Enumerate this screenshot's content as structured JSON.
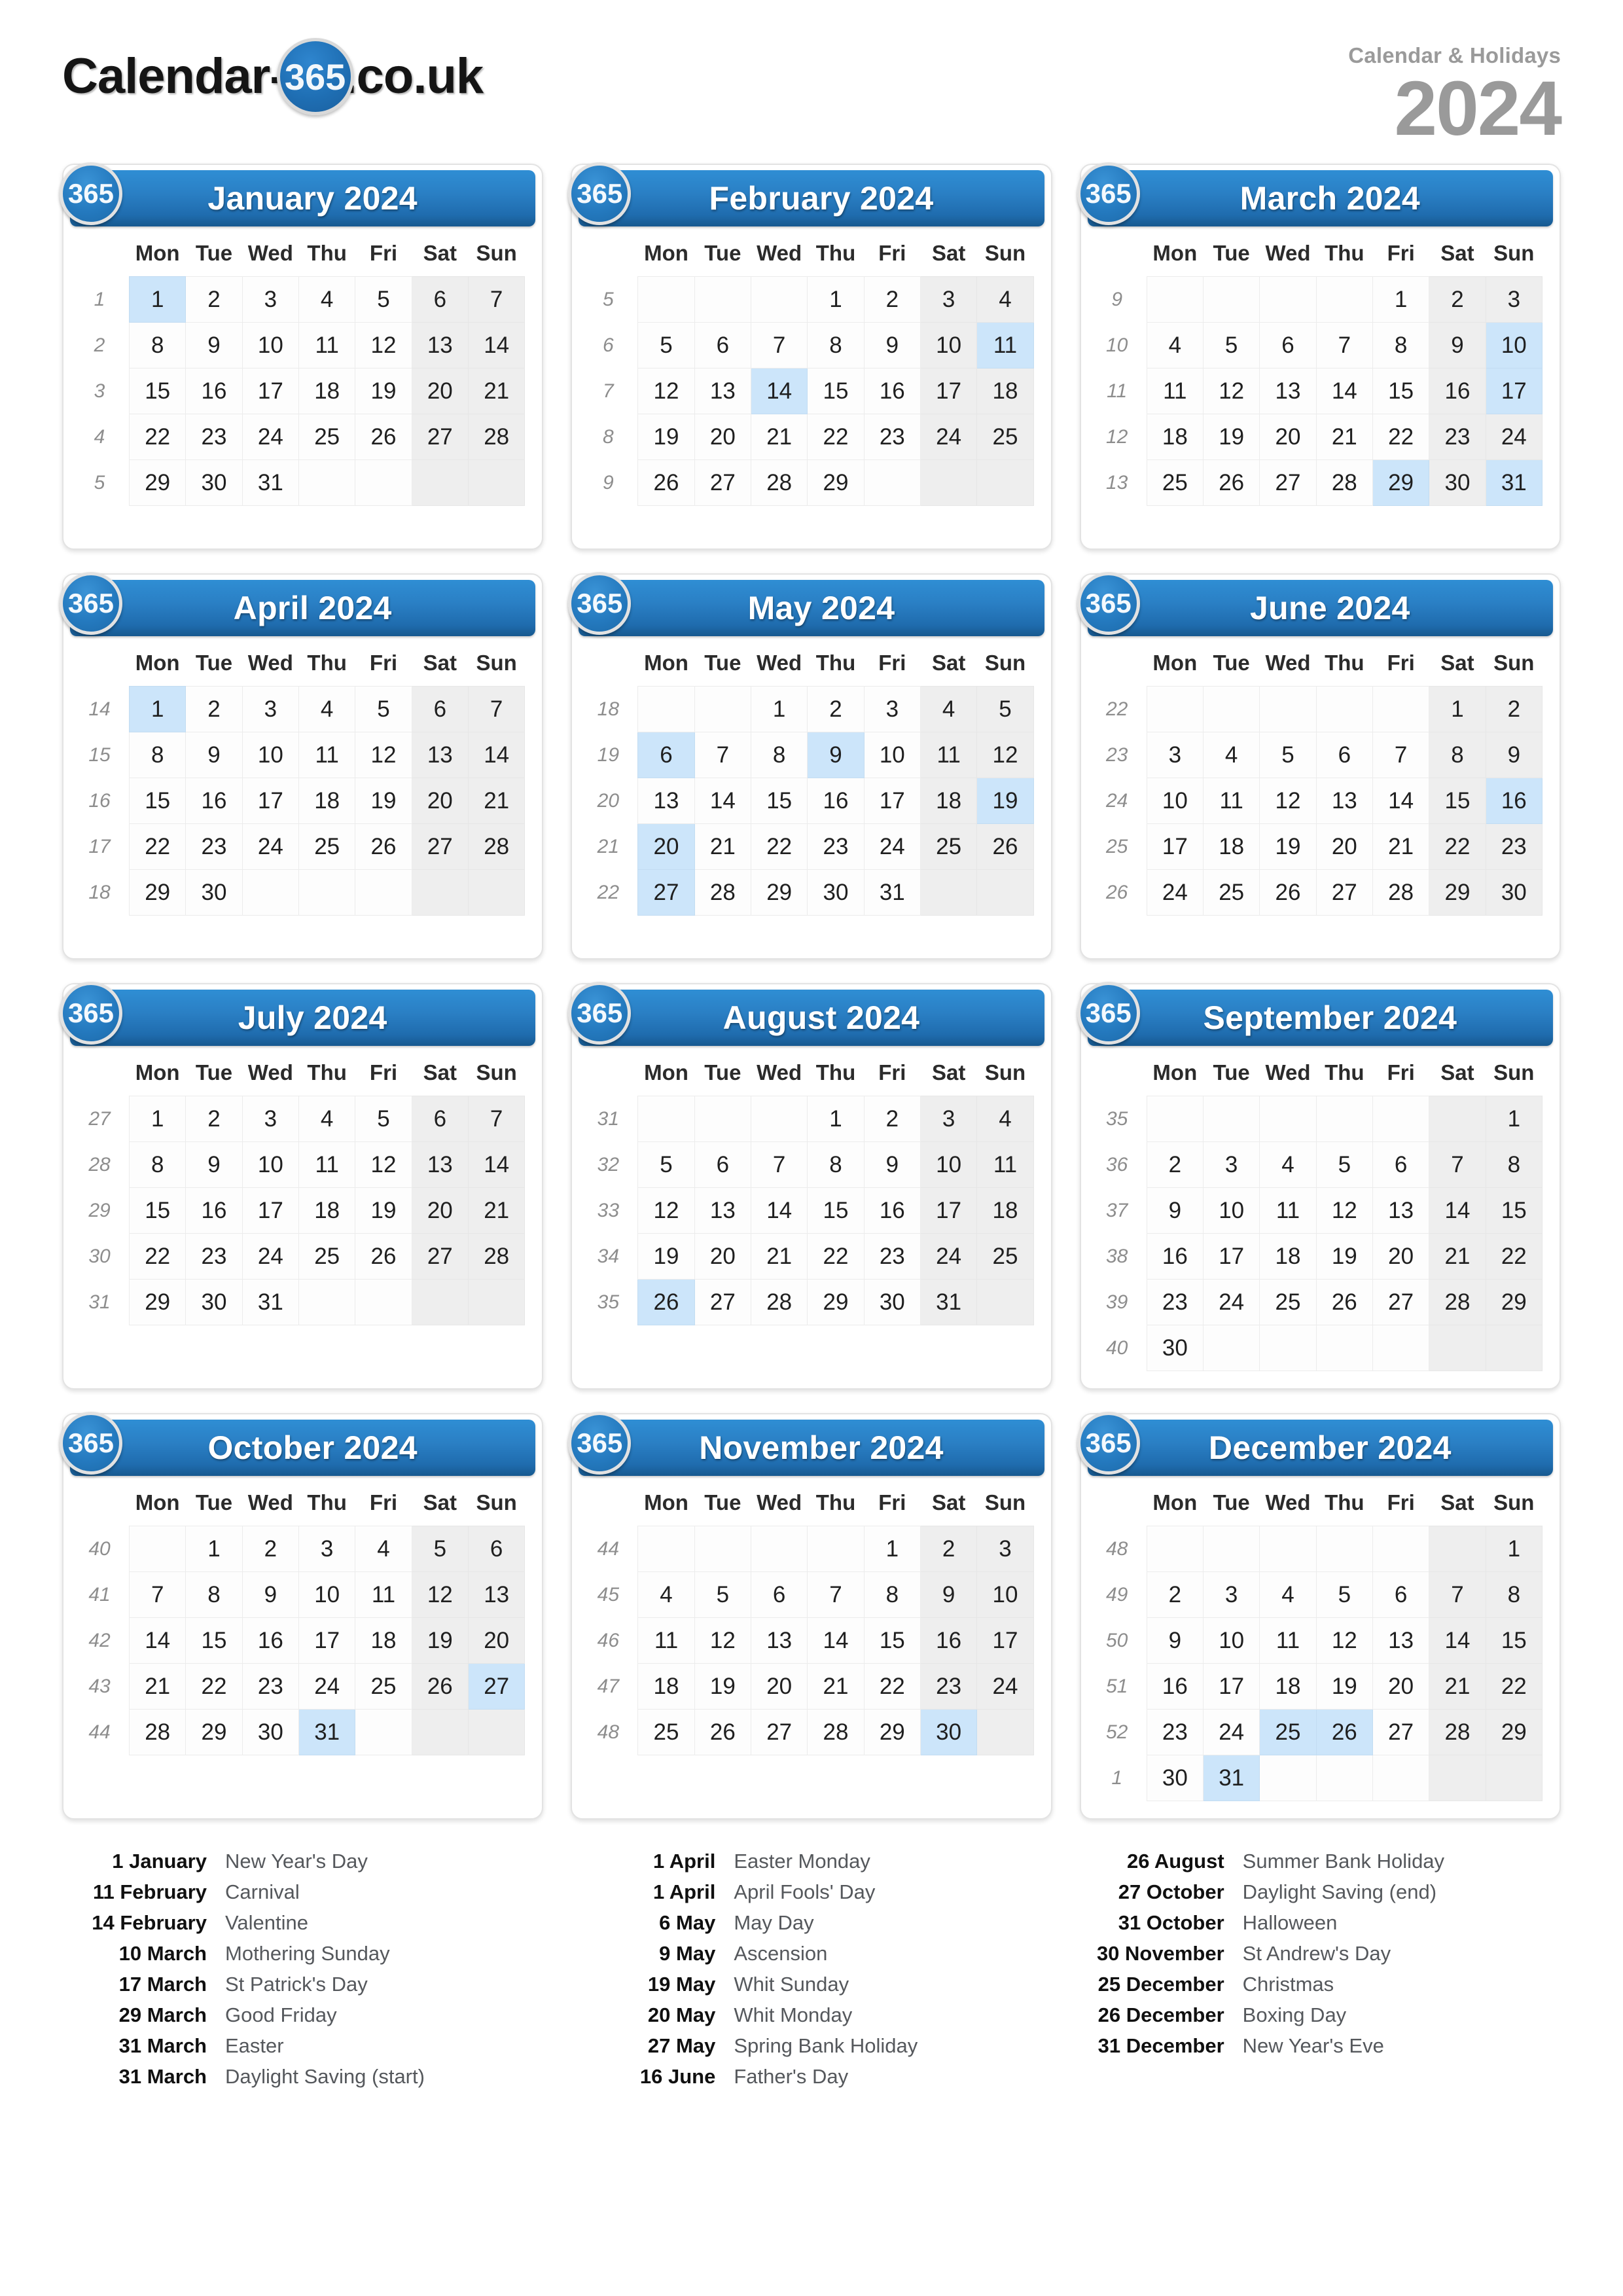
{
  "header": {
    "logo_prefix": "Calendar-",
    "logo_badge": "365",
    "logo_suffix": ".co.uk",
    "kicker": "Calendar & Holidays",
    "year": "2024"
  },
  "colors": {
    "header_blue": "#2a7fc4",
    "badge_blue": "#2479be",
    "highlight": "#cce5fa",
    "weekend": "#eeeeee",
    "muted_text": "#9a9a9a"
  },
  "weekday_labels": [
    "Mon",
    "Tue",
    "Wed",
    "Thu",
    "Fri",
    "Sat",
    "Sun"
  ],
  "badge_label": "365",
  "months": [
    {
      "title": "January 2024",
      "weeks": [
        {
          "no": "1",
          "days": [
            "1",
            "2",
            "3",
            "4",
            "5",
            "6",
            "7"
          ],
          "hl": [
            1
          ]
        },
        {
          "no": "2",
          "days": [
            "8",
            "9",
            "10",
            "11",
            "12",
            "13",
            "14"
          ],
          "hl": []
        },
        {
          "no": "3",
          "days": [
            "15",
            "16",
            "17",
            "18",
            "19",
            "20",
            "21"
          ],
          "hl": []
        },
        {
          "no": "4",
          "days": [
            "22",
            "23",
            "24",
            "25",
            "26",
            "27",
            "28"
          ],
          "hl": []
        },
        {
          "no": "5",
          "days": [
            "29",
            "30",
            "31",
            "",
            "",
            "",
            ""
          ],
          "hl": []
        }
      ]
    },
    {
      "title": "February 2024",
      "weeks": [
        {
          "no": "5",
          "days": [
            "",
            "",
            "",
            "1",
            "2",
            "3",
            "4"
          ],
          "hl": []
        },
        {
          "no": "6",
          "days": [
            "5",
            "6",
            "7",
            "8",
            "9",
            "10",
            "11"
          ],
          "hl": [
            11
          ]
        },
        {
          "no": "7",
          "days": [
            "12",
            "13",
            "14",
            "15",
            "16",
            "17",
            "18"
          ],
          "hl": [
            14
          ]
        },
        {
          "no": "8",
          "days": [
            "19",
            "20",
            "21",
            "22",
            "23",
            "24",
            "25"
          ],
          "hl": []
        },
        {
          "no": "9",
          "days": [
            "26",
            "27",
            "28",
            "29",
            "",
            "",
            ""
          ],
          "hl": []
        }
      ]
    },
    {
      "title": "March 2024",
      "weeks": [
        {
          "no": "9",
          "days": [
            "",
            "",
            "",
            "",
            "1",
            "2",
            "3"
          ],
          "hl": []
        },
        {
          "no": "10",
          "days": [
            "4",
            "5",
            "6",
            "7",
            "8",
            "9",
            "10"
          ],
          "hl": [
            10
          ]
        },
        {
          "no": "11",
          "days": [
            "11",
            "12",
            "13",
            "14",
            "15",
            "16",
            "17"
          ],
          "hl": [
            17
          ]
        },
        {
          "no": "12",
          "days": [
            "18",
            "19",
            "20",
            "21",
            "22",
            "23",
            "24"
          ],
          "hl": []
        },
        {
          "no": "13",
          "days": [
            "25",
            "26",
            "27",
            "28",
            "29",
            "30",
            "31"
          ],
          "hl": [
            29,
            31
          ]
        }
      ]
    },
    {
      "title": "April 2024",
      "weeks": [
        {
          "no": "14",
          "days": [
            "1",
            "2",
            "3",
            "4",
            "5",
            "6",
            "7"
          ],
          "hl": [
            1
          ]
        },
        {
          "no": "15",
          "days": [
            "8",
            "9",
            "10",
            "11",
            "12",
            "13",
            "14"
          ],
          "hl": []
        },
        {
          "no": "16",
          "days": [
            "15",
            "16",
            "17",
            "18",
            "19",
            "20",
            "21"
          ],
          "hl": []
        },
        {
          "no": "17",
          "days": [
            "22",
            "23",
            "24",
            "25",
            "26",
            "27",
            "28"
          ],
          "hl": []
        },
        {
          "no": "18",
          "days": [
            "29",
            "30",
            "",
            "",
            "",
            "",
            ""
          ],
          "hl": []
        }
      ]
    },
    {
      "title": "May 2024",
      "weeks": [
        {
          "no": "18",
          "days": [
            "",
            "",
            "1",
            "2",
            "3",
            "4",
            "5"
          ],
          "hl": []
        },
        {
          "no": "19",
          "days": [
            "6",
            "7",
            "8",
            "9",
            "10",
            "11",
            "12"
          ],
          "hl": [
            6,
            9
          ]
        },
        {
          "no": "20",
          "days": [
            "13",
            "14",
            "15",
            "16",
            "17",
            "18",
            "19"
          ],
          "hl": [
            19
          ]
        },
        {
          "no": "21",
          "days": [
            "20",
            "21",
            "22",
            "23",
            "24",
            "25",
            "26"
          ],
          "hl": [
            20
          ]
        },
        {
          "no": "22",
          "days": [
            "27",
            "28",
            "29",
            "30",
            "31",
            "",
            ""
          ],
          "hl": [
            27
          ]
        }
      ]
    },
    {
      "title": "June 2024",
      "weeks": [
        {
          "no": "22",
          "days": [
            "",
            "",
            "",
            "",
            "",
            "1",
            "2"
          ],
          "hl": []
        },
        {
          "no": "23",
          "days": [
            "3",
            "4",
            "5",
            "6",
            "7",
            "8",
            "9"
          ],
          "hl": []
        },
        {
          "no": "24",
          "days": [
            "10",
            "11",
            "12",
            "13",
            "14",
            "15",
            "16"
          ],
          "hl": [
            16
          ]
        },
        {
          "no": "25",
          "days": [
            "17",
            "18",
            "19",
            "20",
            "21",
            "22",
            "23"
          ],
          "hl": []
        },
        {
          "no": "26",
          "days": [
            "24",
            "25",
            "26",
            "27",
            "28",
            "29",
            "30"
          ],
          "hl": []
        }
      ]
    },
    {
      "title": "July 2024",
      "weeks": [
        {
          "no": "27",
          "days": [
            "1",
            "2",
            "3",
            "4",
            "5",
            "6",
            "7"
          ],
          "hl": []
        },
        {
          "no": "28",
          "days": [
            "8",
            "9",
            "10",
            "11",
            "12",
            "13",
            "14"
          ],
          "hl": []
        },
        {
          "no": "29",
          "days": [
            "15",
            "16",
            "17",
            "18",
            "19",
            "20",
            "21"
          ],
          "hl": []
        },
        {
          "no": "30",
          "days": [
            "22",
            "23",
            "24",
            "25",
            "26",
            "27",
            "28"
          ],
          "hl": []
        },
        {
          "no": "31",
          "days": [
            "29",
            "30",
            "31",
            "",
            "",
            "",
            ""
          ],
          "hl": []
        }
      ]
    },
    {
      "title": "August 2024",
      "weeks": [
        {
          "no": "31",
          "days": [
            "",
            "",
            "",
            "1",
            "2",
            "3",
            "4"
          ],
          "hl": []
        },
        {
          "no": "32",
          "days": [
            "5",
            "6",
            "7",
            "8",
            "9",
            "10",
            "11"
          ],
          "hl": []
        },
        {
          "no": "33",
          "days": [
            "12",
            "13",
            "14",
            "15",
            "16",
            "17",
            "18"
          ],
          "hl": []
        },
        {
          "no": "34",
          "days": [
            "19",
            "20",
            "21",
            "22",
            "23",
            "24",
            "25"
          ],
          "hl": []
        },
        {
          "no": "35",
          "days": [
            "26",
            "27",
            "28",
            "29",
            "30",
            "31",
            ""
          ],
          "hl": [
            26
          ]
        }
      ]
    },
    {
      "title": "September 2024",
      "weeks": [
        {
          "no": "35",
          "days": [
            "",
            "",
            "",
            "",
            "",
            "",
            "1"
          ],
          "hl": []
        },
        {
          "no": "36",
          "days": [
            "2",
            "3",
            "4",
            "5",
            "6",
            "7",
            "8"
          ],
          "hl": []
        },
        {
          "no": "37",
          "days": [
            "9",
            "10",
            "11",
            "12",
            "13",
            "14",
            "15"
          ],
          "hl": []
        },
        {
          "no": "38",
          "days": [
            "16",
            "17",
            "18",
            "19",
            "20",
            "21",
            "22"
          ],
          "hl": []
        },
        {
          "no": "39",
          "days": [
            "23",
            "24",
            "25",
            "26",
            "27",
            "28",
            "29"
          ],
          "hl": []
        },
        {
          "no": "40",
          "days": [
            "30",
            "",
            "",
            "",
            "",
            "",
            ""
          ],
          "hl": []
        }
      ]
    },
    {
      "title": "October 2024",
      "weeks": [
        {
          "no": "40",
          "days": [
            "",
            "1",
            "2",
            "3",
            "4",
            "5",
            "6"
          ],
          "hl": []
        },
        {
          "no": "41",
          "days": [
            "7",
            "8",
            "9",
            "10",
            "11",
            "12",
            "13"
          ],
          "hl": []
        },
        {
          "no": "42",
          "days": [
            "14",
            "15",
            "16",
            "17",
            "18",
            "19",
            "20"
          ],
          "hl": []
        },
        {
          "no": "43",
          "days": [
            "21",
            "22",
            "23",
            "24",
            "25",
            "26",
            "27"
          ],
          "hl": [
            27
          ]
        },
        {
          "no": "44",
          "days": [
            "28",
            "29",
            "30",
            "31",
            "",
            "",
            ""
          ],
          "hl": [
            31
          ]
        }
      ]
    },
    {
      "title": "November 2024",
      "weeks": [
        {
          "no": "44",
          "days": [
            "",
            "",
            "",
            "",
            "1",
            "2",
            "3"
          ],
          "hl": []
        },
        {
          "no": "45",
          "days": [
            "4",
            "5",
            "6",
            "7",
            "8",
            "9",
            "10"
          ],
          "hl": []
        },
        {
          "no": "46",
          "days": [
            "11",
            "12",
            "13",
            "14",
            "15",
            "16",
            "17"
          ],
          "hl": []
        },
        {
          "no": "47",
          "days": [
            "18",
            "19",
            "20",
            "21",
            "22",
            "23",
            "24"
          ],
          "hl": []
        },
        {
          "no": "48",
          "days": [
            "25",
            "26",
            "27",
            "28",
            "29",
            "30",
            ""
          ],
          "hl": [
            30
          ]
        }
      ]
    },
    {
      "title": "December 2024",
      "weeks": [
        {
          "no": "48",
          "days": [
            "",
            "",
            "",
            "",
            "",
            "",
            "1"
          ],
          "hl": []
        },
        {
          "no": "49",
          "days": [
            "2",
            "3",
            "4",
            "5",
            "6",
            "7",
            "8"
          ],
          "hl": []
        },
        {
          "no": "50",
          "days": [
            "9",
            "10",
            "11",
            "12",
            "13",
            "14",
            "15"
          ],
          "hl": []
        },
        {
          "no": "51",
          "days": [
            "16",
            "17",
            "18",
            "19",
            "20",
            "21",
            "22"
          ],
          "hl": []
        },
        {
          "no": "52",
          "days": [
            "23",
            "24",
            "25",
            "26",
            "27",
            "28",
            "29"
          ],
          "hl": [
            25,
            26
          ]
        },
        {
          "no": "1",
          "days": [
            "30",
            "31",
            "",
            "",
            "",
            "",
            ""
          ],
          "hl": [
            31
          ]
        }
      ]
    }
  ],
  "holiday_columns": [
    [
      {
        "date": "1 January",
        "name": "New Year's Day"
      },
      {
        "date": "11 February",
        "name": "Carnival"
      },
      {
        "date": "14 February",
        "name": "Valentine"
      },
      {
        "date": "10 March",
        "name": "Mothering Sunday"
      },
      {
        "date": "17 March",
        "name": "St Patrick's Day"
      },
      {
        "date": "29 March",
        "name": "Good Friday"
      },
      {
        "date": "31 March",
        "name": "Easter"
      },
      {
        "date": "31 March",
        "name": "Daylight Saving (start)"
      }
    ],
    [
      {
        "date": "1 April",
        "name": "Easter Monday"
      },
      {
        "date": "1 April",
        "name": "April Fools' Day"
      },
      {
        "date": "6 May",
        "name": "May Day"
      },
      {
        "date": "9 May",
        "name": "Ascension"
      },
      {
        "date": "19 May",
        "name": "Whit Sunday"
      },
      {
        "date": "20 May",
        "name": "Whit Monday"
      },
      {
        "date": "27 May",
        "name": "Spring Bank Holiday"
      },
      {
        "date": "16 June",
        "name": "Father's Day"
      }
    ],
    [
      {
        "date": "26 August",
        "name": "Summer Bank Holiday"
      },
      {
        "date": "27 October",
        "name": "Daylight Saving (end)"
      },
      {
        "date": "31 October",
        "name": "Halloween"
      },
      {
        "date": "30 November",
        "name": "St Andrew's Day"
      },
      {
        "date": "25 December",
        "name": "Christmas"
      },
      {
        "date": "26 December",
        "name": "Boxing Day"
      },
      {
        "date": "31 December",
        "name": "New Year's Eve"
      }
    ]
  ]
}
